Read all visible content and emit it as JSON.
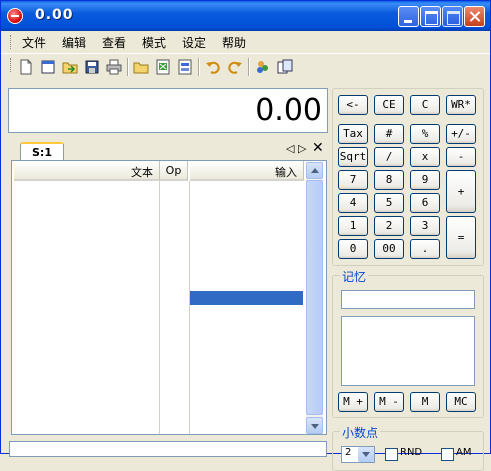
{
  "window": {
    "title": "0.00"
  },
  "menu": {
    "items": [
      "文件",
      "编辑",
      "查看",
      "模式",
      "设定",
      "帮助"
    ]
  },
  "toolbar": {
    "icons": [
      "new-icon",
      "open-doc-icon",
      "import-icon",
      "save-icon",
      "print-icon",
      "open-folder-icon",
      "export-excel-icon",
      "export-icon",
      "undo-icon",
      "redo-icon",
      "users-icon",
      "window-icon"
    ]
  },
  "display": {
    "value": "0.00"
  },
  "tabs": {
    "active": "S:1",
    "nav": "◁ ▷",
    "close": "✕"
  },
  "grid": {
    "columns": [
      "文本",
      "Op",
      "输入"
    ]
  },
  "keypad": {
    "backspace": "<-",
    "ce": "CE",
    "c": "C",
    "wr": "WR*",
    "tax": "Tax",
    "hash": "#",
    "percent": "%",
    "plusminus": "+/-",
    "sqrt": "Sqrt",
    "divide": "/",
    "multiply": "x",
    "minus": "-",
    "k7": "7",
    "k8": "8",
    "k9": "9",
    "plus": "+",
    "k4": "4",
    "k5": "5",
    "k6": "6",
    "k1": "1",
    "k2": "2",
    "k3": "3",
    "equals": "=",
    "k0": "0",
    "k00": "00",
    "dot": "."
  },
  "memory": {
    "title": "记忆",
    "buttons": [
      "M +",
      "M -",
      "M",
      "MC"
    ]
  },
  "decimal": {
    "title": "小数点",
    "value": "2",
    "rnd_label": "RND",
    "am_label": "AM"
  }
}
